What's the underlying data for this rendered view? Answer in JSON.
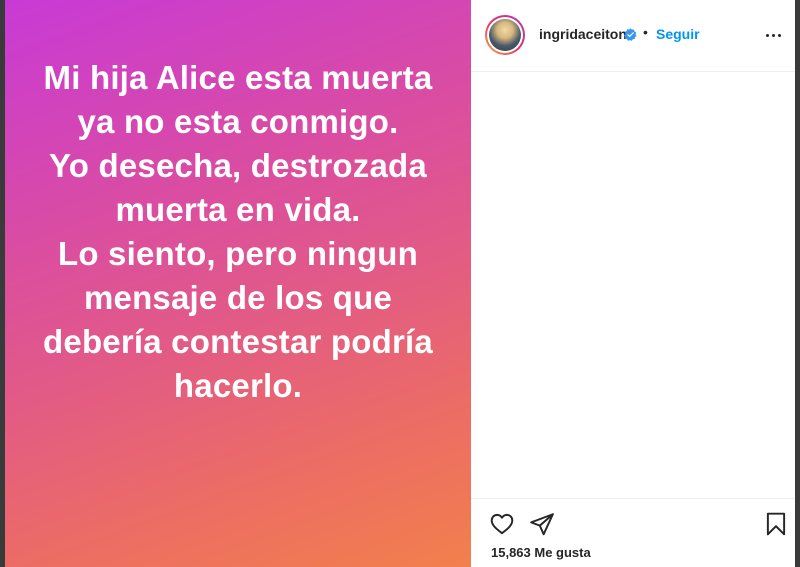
{
  "post": {
    "text_lines": [
      "Mi hija Alice esta muerta",
      "ya no esta conmigo.",
      "Yo desecha, destrozada",
      "muerta en vida.",
      "Lo siento, pero ningun",
      "mensaje de los que",
      "debería contestar podría",
      "hacerlo."
    ],
    "gradient_colors": [
      "#c83ad6",
      "#e25a86",
      "#f2804c"
    ]
  },
  "header": {
    "username": "ingridaceiton",
    "separator": "•",
    "follow_label": "Seguir",
    "verified": true,
    "icons": {
      "verified": "verified-badge-icon",
      "more": "more-options-icon"
    }
  },
  "actions": {
    "icons": [
      "heart-icon",
      "share-icon",
      "bookmark-icon"
    ],
    "likes_label": "15,863 Me gusta"
  },
  "colors": {
    "link_blue": "#0095f6",
    "text_dark": "#262626",
    "divider": "#efefef"
  }
}
